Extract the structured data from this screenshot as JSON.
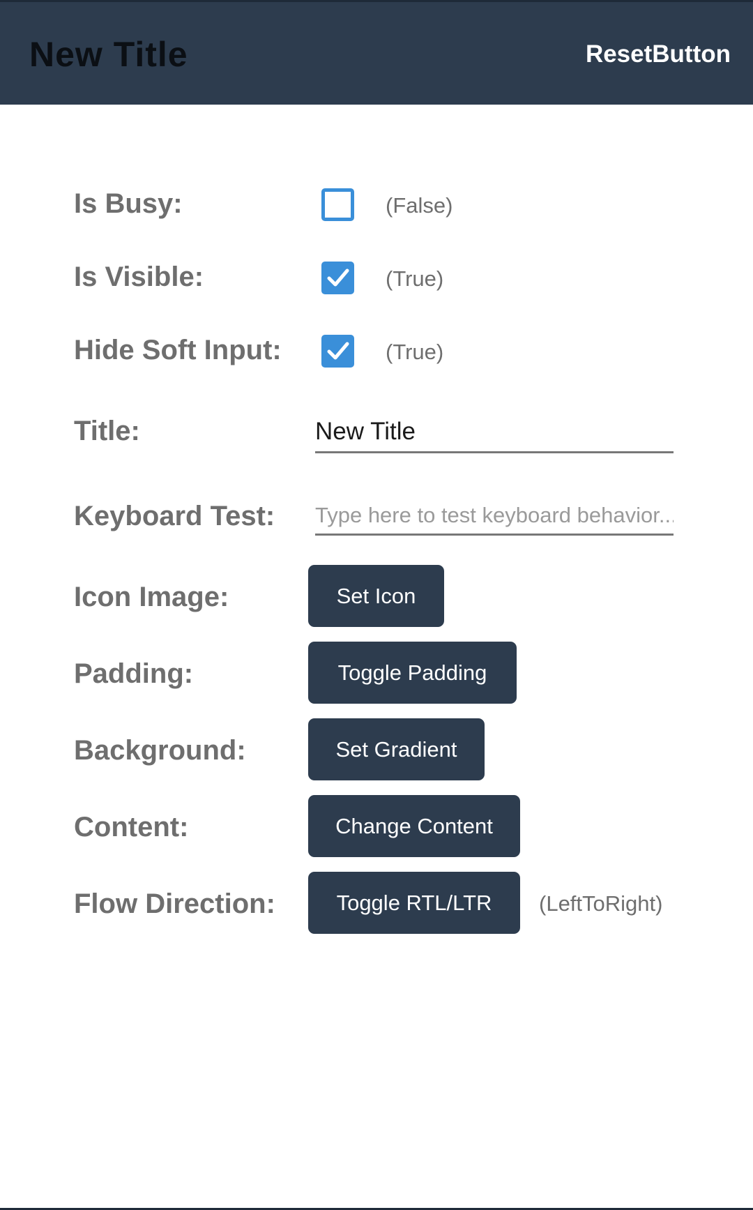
{
  "header": {
    "title": "New Title",
    "reset_label": "ResetButton"
  },
  "rows": {
    "is_busy": {
      "label": "Is Busy:",
      "checked": false,
      "state": "(False)"
    },
    "is_visible": {
      "label": "Is Visible:",
      "checked": true,
      "state": "(True)"
    },
    "hide_soft_input": {
      "label": "Hide Soft Input:",
      "checked": true,
      "state": "(True)"
    },
    "title": {
      "label": "Title:",
      "value": "New Title"
    },
    "keyboard_test": {
      "label": "Keyboard Test:",
      "value": "",
      "placeholder": "Type here to test keyboard behavior..."
    },
    "icon_image": {
      "label": "Icon Image:",
      "button": "Set Icon"
    },
    "padding": {
      "label": "Padding:",
      "button": "Toggle Padding"
    },
    "background": {
      "label": "Background:",
      "button": "Set Gradient"
    },
    "content": {
      "label": "Content:",
      "button": "Change Content"
    },
    "flow_direction": {
      "label": "Flow Direction:",
      "button": "Toggle RTL/LTR",
      "state": "(LeftToRight)"
    }
  },
  "colors": {
    "navbar": "#2d3c4e",
    "checkbox_accent": "#3a8fd9",
    "label_gray": "#6e6e6e",
    "button_bg": "#2d3c4e"
  },
  "icons": {
    "checkmark": "checkmark-icon"
  }
}
